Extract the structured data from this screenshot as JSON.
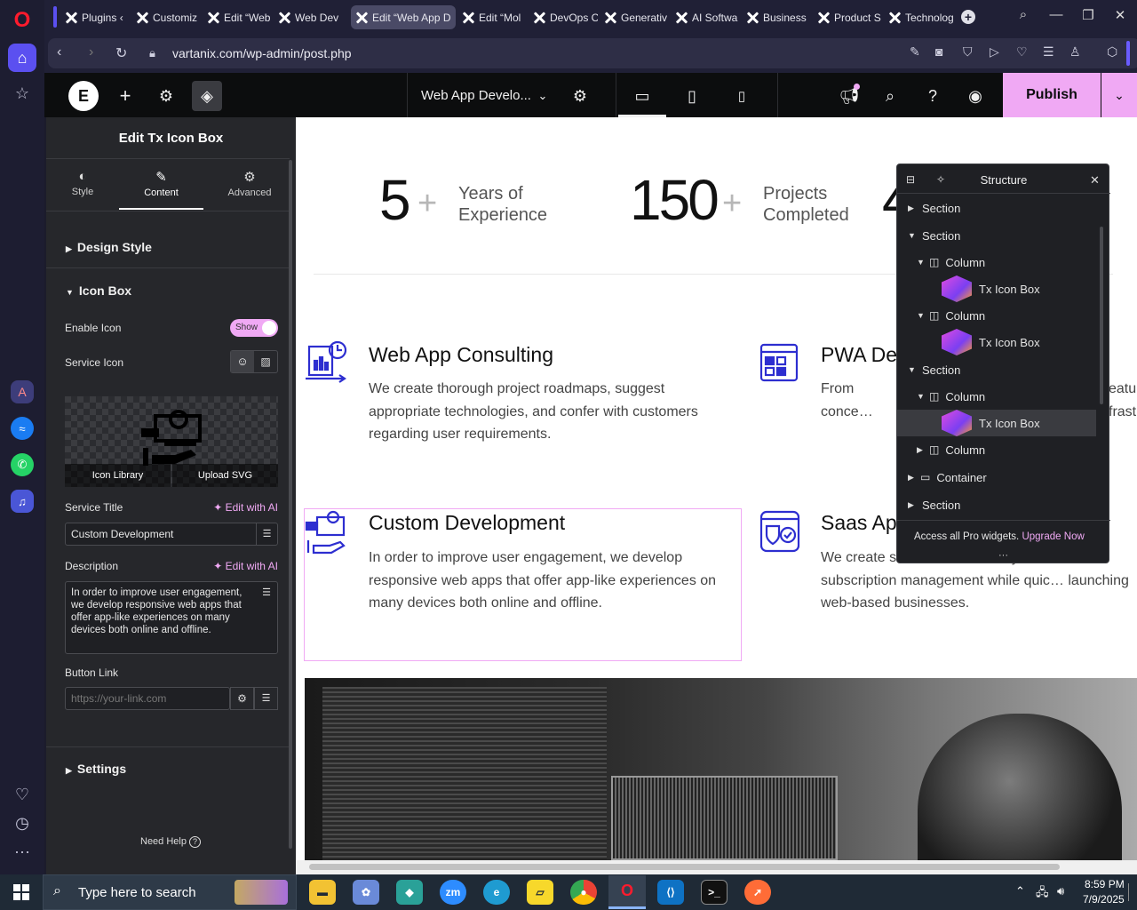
{
  "browser": {
    "tabs": [
      {
        "label": "Plugins ‹"
      },
      {
        "label": "Customiz"
      },
      {
        "label": "Edit “Web"
      },
      {
        "label": "Web Dev"
      },
      {
        "label": "Edit “Web App D"
      },
      {
        "label": "Edit “Mol"
      },
      {
        "label": "DevOps C"
      },
      {
        "label": "Generativ"
      },
      {
        "label": "AI Softwa"
      },
      {
        "label": "Business"
      },
      {
        "label": "Product S"
      },
      {
        "label": "Technolog"
      }
    ],
    "url": "vartanix.com/wp-admin/post.php"
  },
  "topbar": {
    "page_title": "Web App Develo...",
    "publish_label": "Publish"
  },
  "panel": {
    "title": "Edit Tx Icon Box",
    "tabs": {
      "style": "Style",
      "content": "Content",
      "advanced": "Advanced"
    },
    "design_style": "Design Style",
    "icon_box": "Icon Box",
    "enable_icon_label": "Enable Icon",
    "toggle_label": "Show",
    "service_icon_label": "Service Icon",
    "icon_library": "Icon Library",
    "upload_svg": "Upload SVG",
    "service_title_label": "Service Title",
    "edit_with_ai": "Edit with AI",
    "service_title_value": "Custom Development",
    "description_label": "Description",
    "description_value": "In order to improve user engagement, we develop responsive web apps that offer app-like experiences on many devices both online and offline.",
    "button_link_label": "Button Link",
    "button_link_placeholder": "https://your-link.com",
    "settings": "Settings",
    "need_help": "Need Help"
  },
  "canvas": {
    "stats": [
      {
        "number": "5",
        "plus": "+",
        "line1": "Years of",
        "line2": "Experience"
      },
      {
        "number": "150",
        "plus": "+",
        "line1": "Projects",
        "line2": "Completed"
      },
      {
        "number": "4"
      }
    ],
    "services": [
      {
        "title": "Web App Consulting",
        "desc": "We create thorough project roadmaps, suggest appropriate technologies, and confer with customers regarding user requirements."
      },
      {
        "title": "PWA De",
        "desc": "From conce… web apps th… feature… infrast…"
      },
      {
        "title": "Custom Development",
        "desc": "In order to improve user engagement, we develop responsive web apps that offer app-like experiences on many devices both online and offline."
      },
      {
        "title": "Saas Ap",
        "desc": "We create sa… consoli… analytics and subscription management while quic… launching web-based businesses."
      }
    ]
  },
  "structure": {
    "title": "Structure",
    "rows": [
      {
        "label": "Section"
      },
      {
        "label": "Section"
      },
      {
        "label": "Column"
      },
      {
        "label": "Tx Icon Box"
      },
      {
        "label": "Column"
      },
      {
        "label": "Tx Icon Box"
      },
      {
        "label": "Section"
      },
      {
        "label": "Column"
      },
      {
        "label": "Tx Icon Box"
      },
      {
        "label": "Column"
      },
      {
        "label": "Container"
      },
      {
        "label": "Section"
      }
    ],
    "promo": "Access all Pro widgets.",
    "upgrade": "Upgrade Now"
  },
  "taskbar": {
    "search_placeholder": "Type here to search",
    "time": "8:59 PM",
    "date": "7/9/2025"
  },
  "colors": {
    "accent_pink": "#f0a9f4",
    "icon_blue": "#2d2ed0",
    "publish_bg": "#f0a9f4"
  }
}
